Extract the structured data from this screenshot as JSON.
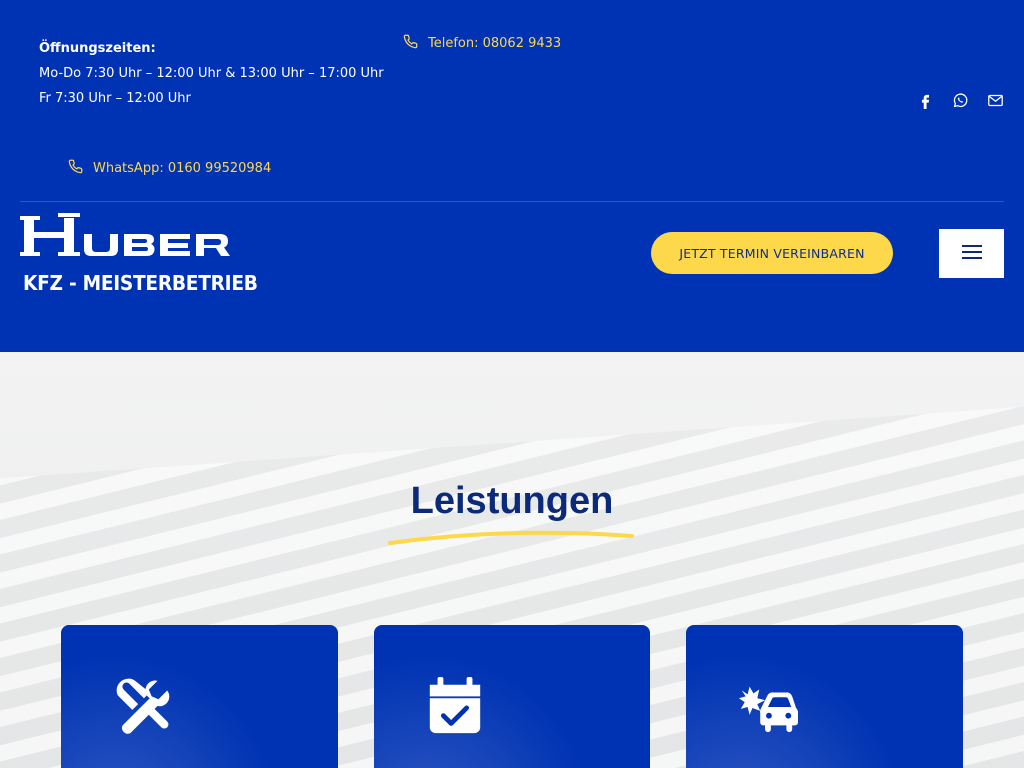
{
  "header": {
    "hours_title": "Öffnungszeiten:",
    "hours_line1": "Mo-Do 7:30 Uhr – 12:00 Uhr & 13:00 Uhr – 17:00 Uhr",
    "hours_line2": "Fr 7:30 Uhr – 12:00 Uhr",
    "phone_text": "Telefon: 08062 9433",
    "whatsapp_text": "WhatsApp: 0160 99520984",
    "social": [
      "facebook-icon",
      "whatsapp-icon",
      "mail-icon"
    ],
    "logo_wordmark": "HUBER",
    "logo_subtitle": "KFZ - MEISTERBETRIEB",
    "cta_label": "JETZT TERMIN VEREINBAREN",
    "menu_icon": "hamburger-icon"
  },
  "section": {
    "title": "Leistungen",
    "cards": [
      {
        "icon": "tools-icon"
      },
      {
        "icon": "calendar-check-icon"
      },
      {
        "icon": "car-crash-icon"
      }
    ]
  },
  "colors": {
    "brand_blue": "#0033b3",
    "accent_yellow": "#fcd84a",
    "heading_blue": "#0b2a7a"
  }
}
